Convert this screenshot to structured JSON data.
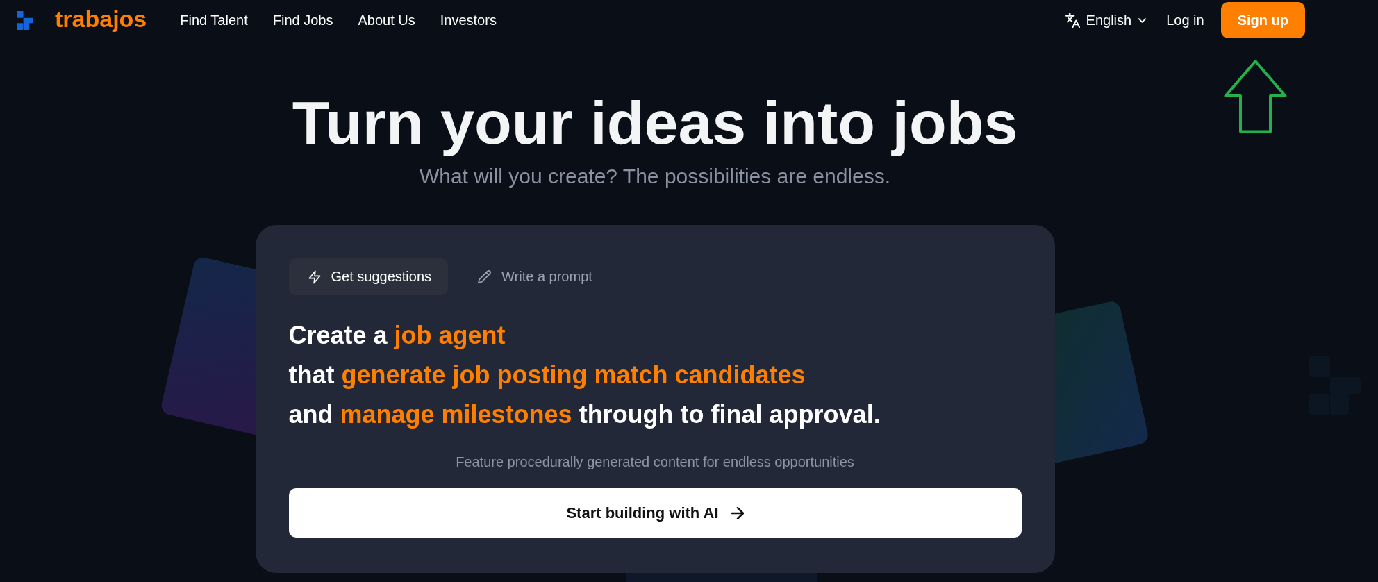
{
  "nav": {
    "brand": "trabajos",
    "links": [
      "Find Talent",
      "Find Jobs",
      "About Us",
      "Investors"
    ],
    "language": "English",
    "login": "Log in",
    "signup": "Sign up"
  },
  "hero": {
    "title": "Turn your ideas into jobs",
    "subtitle": "What will you create? The possibilities are endless."
  },
  "prompt_card": {
    "tabs": [
      {
        "label": "Get suggestions",
        "selected": true
      },
      {
        "label": "Write a prompt",
        "selected": false
      }
    ],
    "lines": [
      {
        "segments": [
          {
            "text": "Create a ",
            "highlight": false
          },
          {
            "text": "job agent",
            "highlight": true
          }
        ]
      },
      {
        "segments": [
          {
            "text": "that ",
            "highlight": false
          },
          {
            "text": "generate job posting match candidates",
            "highlight": true
          }
        ]
      },
      {
        "segments": [
          {
            "text": "and ",
            "highlight": false
          },
          {
            "text": "manage milestones",
            "highlight": true
          },
          {
            "text": " through to final approval.",
            "highlight": false
          }
        ]
      }
    ],
    "caption": "Feature procedurally generated content for endless opportunities",
    "button": "Start building with AI"
  }
}
